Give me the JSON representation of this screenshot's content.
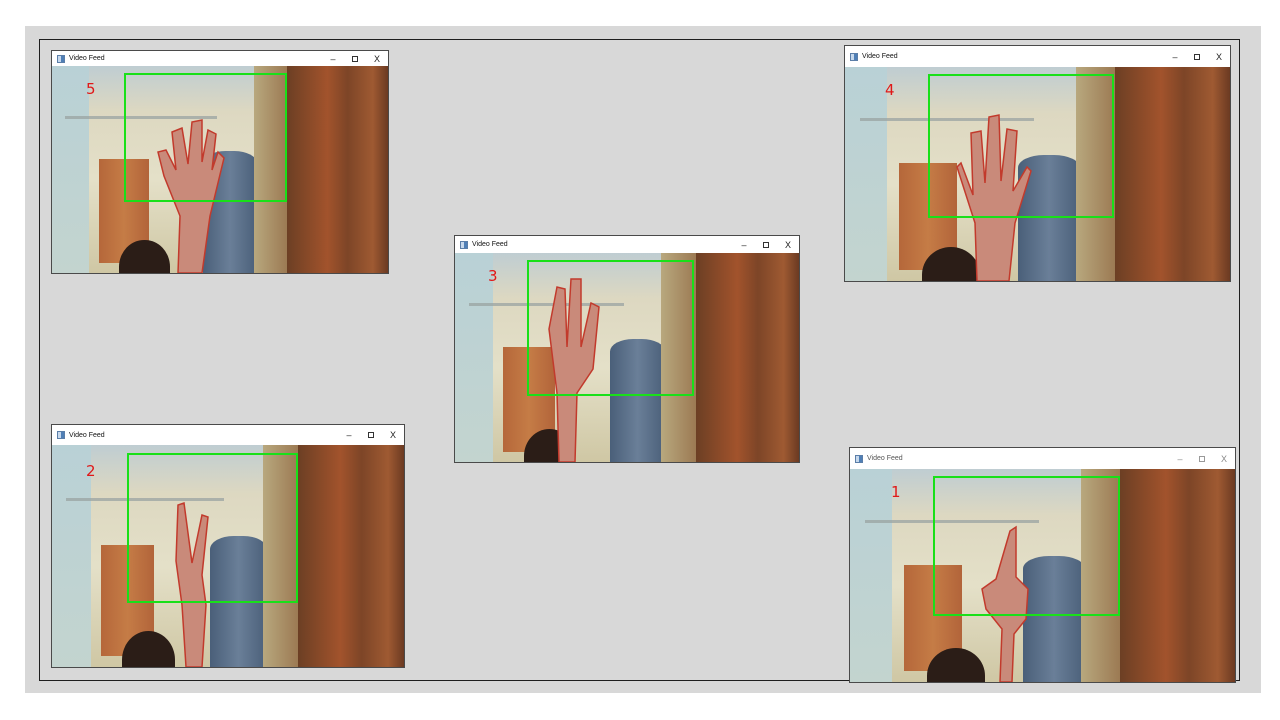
{
  "windows": [
    {
      "title": "Video Feed",
      "minimize": "–",
      "close": "X",
      "count": "5"
    },
    {
      "title": "Video Feed",
      "minimize": "–",
      "close": "X",
      "count": "4"
    },
    {
      "title": "Video Feed",
      "minimize": "–",
      "close": "X",
      "count": "3"
    },
    {
      "title": "Video Feed",
      "minimize": "–",
      "close": "X",
      "count": "2"
    },
    {
      "title": "Video Feed",
      "minimize": "–",
      "close": "X",
      "count": "1"
    }
  ],
  "colors": {
    "roi_box": "#19e019",
    "count_text": "#e01818",
    "hand_contour": "#c23a2c"
  },
  "icons": {
    "app": "app-window-icon",
    "minimize": "minimize-icon",
    "maximize": "maximize-icon",
    "close": "close-icon"
  }
}
